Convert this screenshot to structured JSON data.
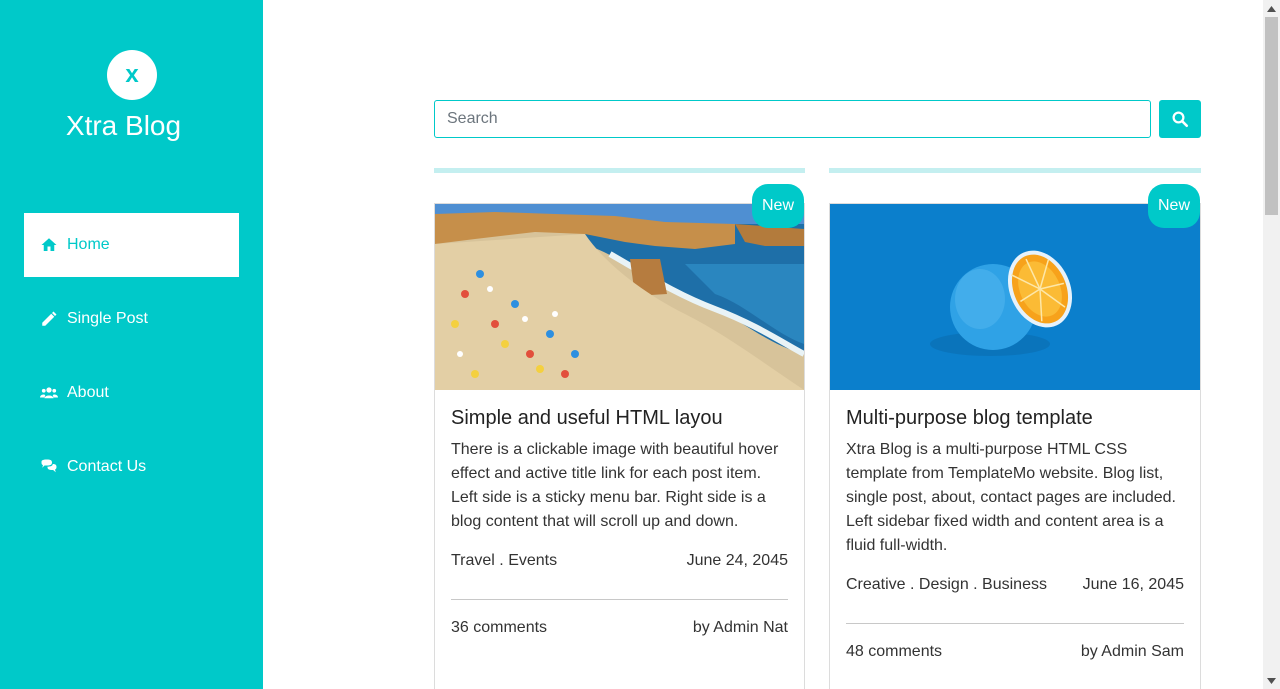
{
  "sidebar": {
    "logo_letter": "x",
    "title": "Xtra Blog",
    "items": [
      {
        "label": "Home",
        "icon": "home-icon",
        "active": true
      },
      {
        "label": "Single Post",
        "icon": "pencil-icon",
        "active": false
      },
      {
        "label": "About",
        "icon": "users-icon",
        "active": false
      },
      {
        "label": "Contact Us",
        "icon": "comments-icon",
        "active": false
      }
    ]
  },
  "search": {
    "placeholder": "Search",
    "value": ""
  },
  "posts": [
    {
      "badge": "New",
      "title": "Simple and useful HTML layou",
      "body": "There is a clickable image with beautiful hover effect and active title link for each post item. Left side is a sticky menu bar. Right side is a blog content that will scroll up and down.",
      "categories": "Travel . Events",
      "date": "June 24, 2045",
      "comments": "36 comments",
      "author": "by Admin Nat"
    },
    {
      "badge": "New",
      "title": "Multi-purpose blog template",
      "body": "Xtra Blog is a multi-purpose HTML CSS template from TemplateMo website. Blog list, single post, about, contact pages are included. Left sidebar fixed width and content area is a fluid full-width.",
      "categories": "Creative . Design . Business",
      "date": "June 16, 2045",
      "comments": "48 comments",
      "author": "by Admin Sam"
    }
  ],
  "colors": {
    "accent": "#00c9c9",
    "accent_light": "#c4eff0"
  }
}
